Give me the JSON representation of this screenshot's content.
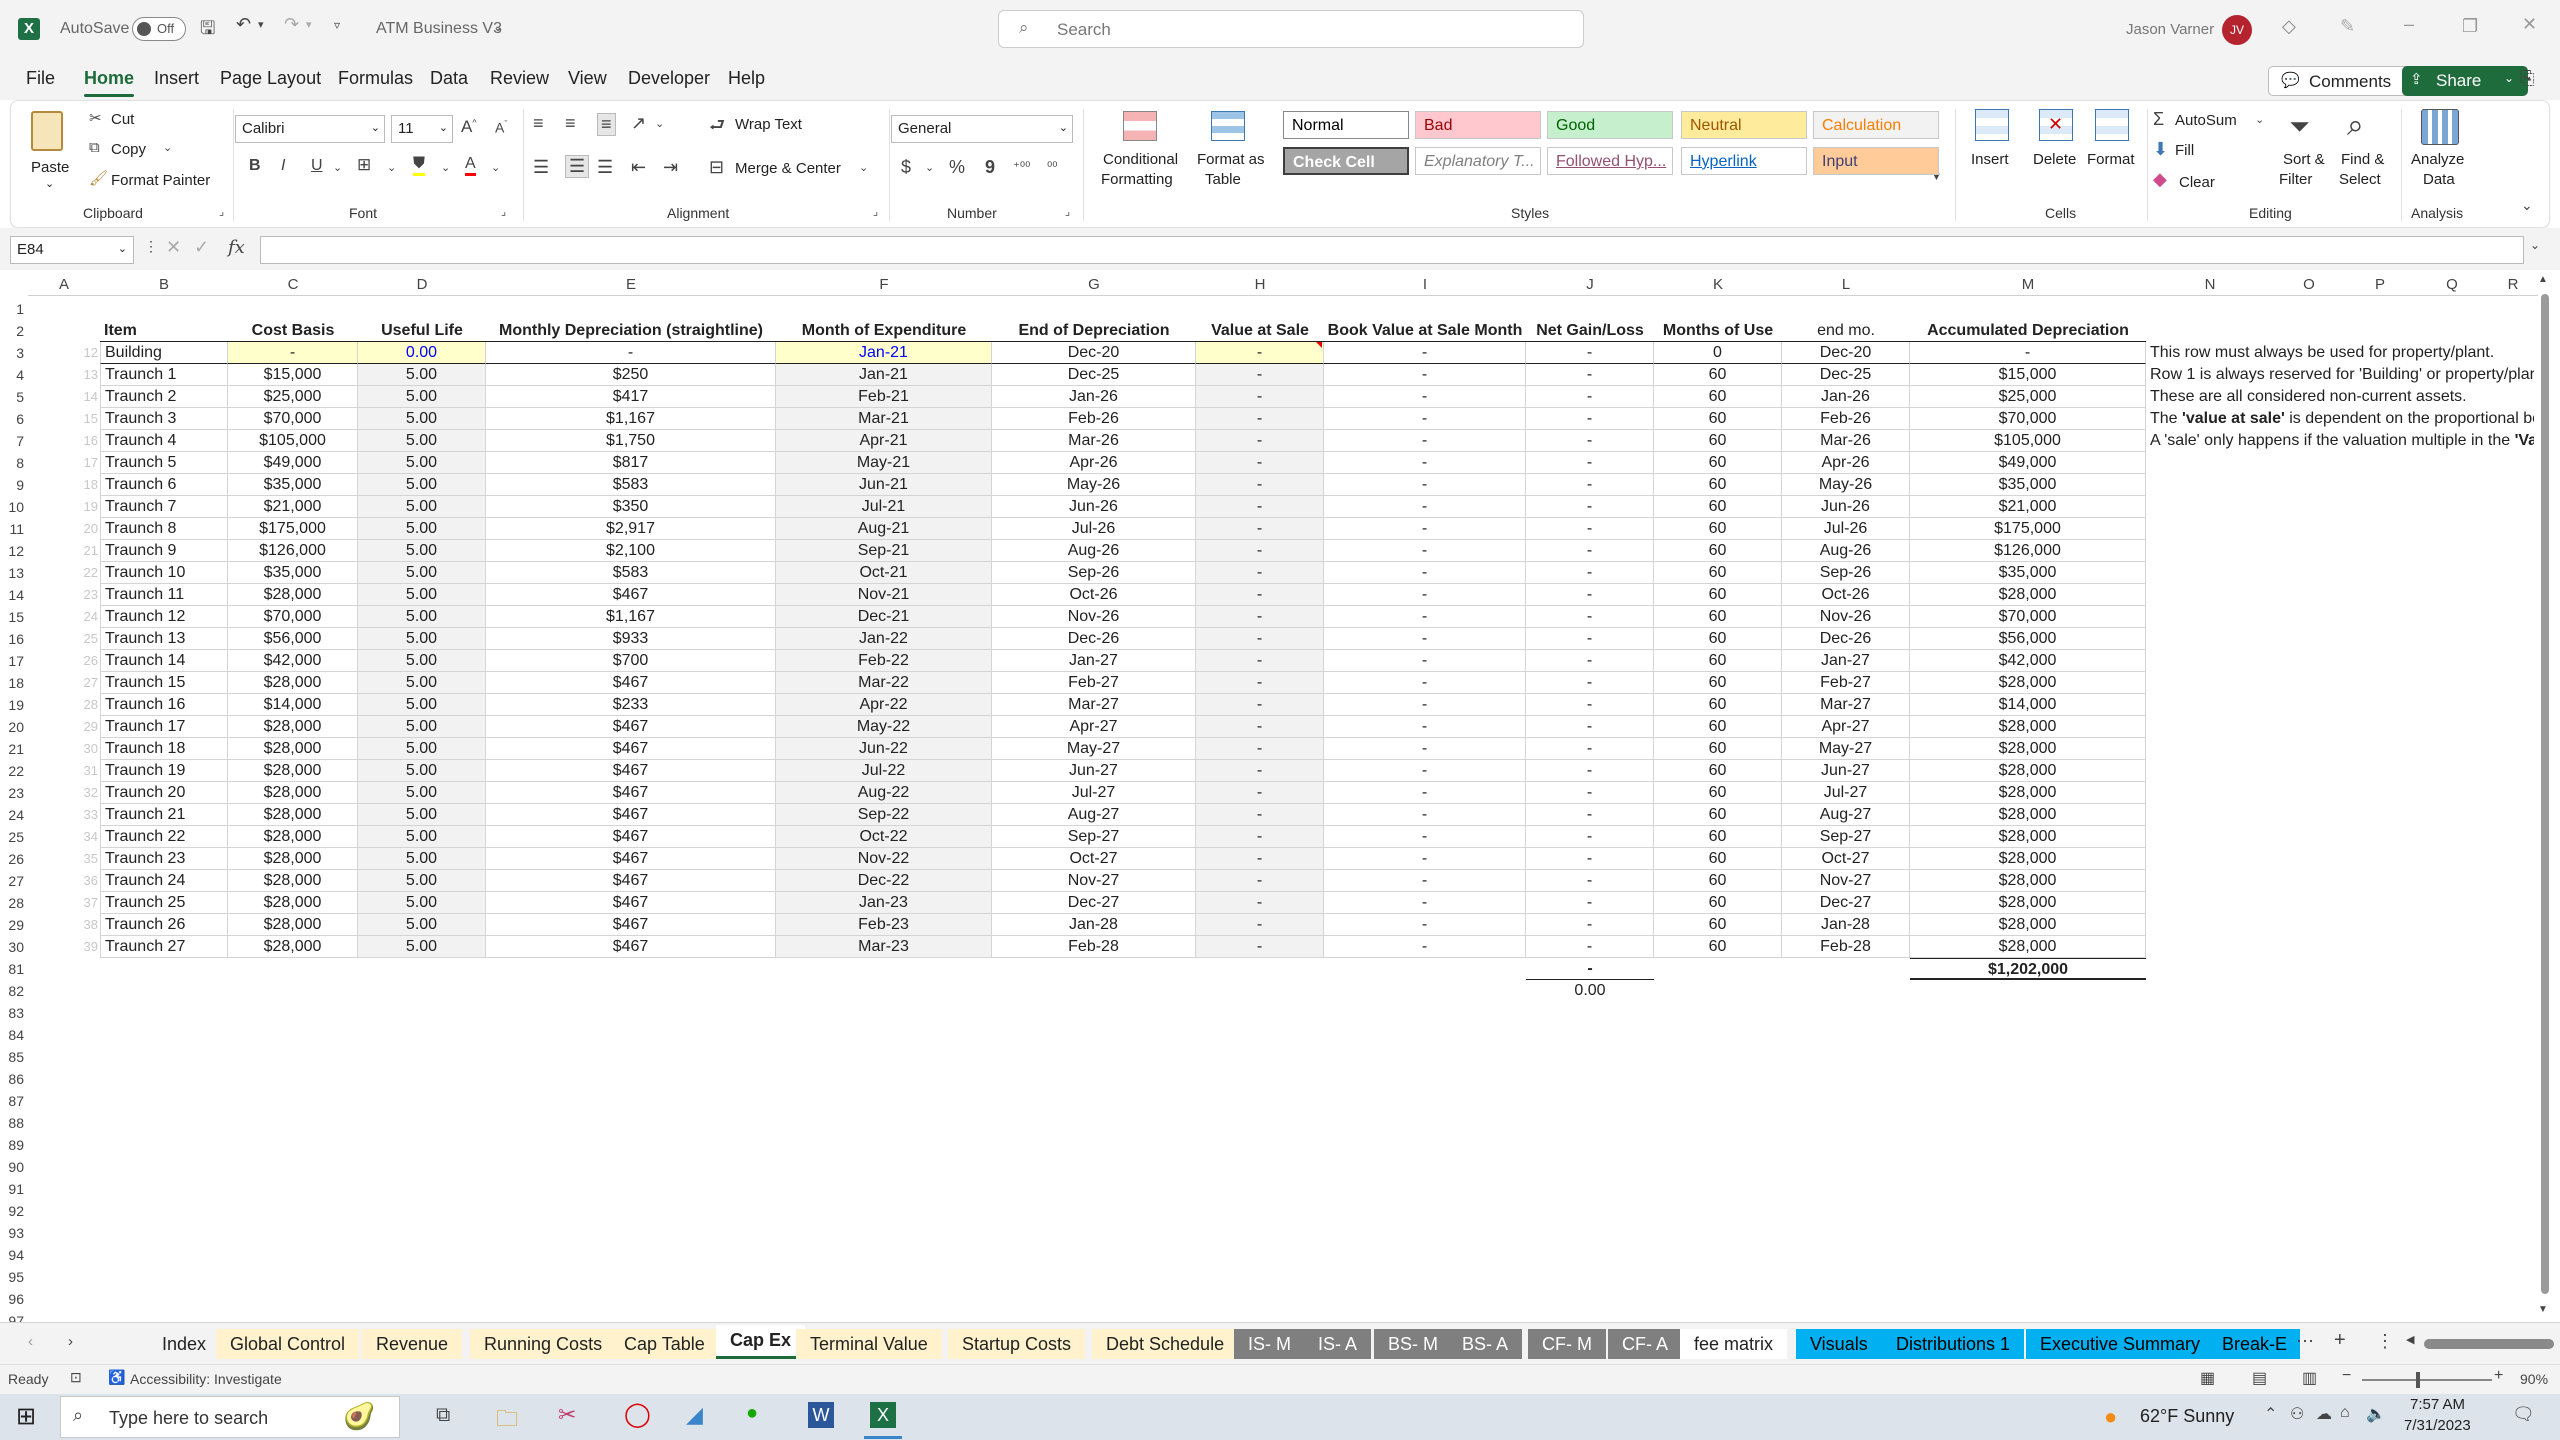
{
  "titlebar": {
    "autosave_label": "AutoSave",
    "autosave_state": "Off",
    "filename": "ATM Business V3",
    "search_placeholder": "Search",
    "user_name": "Jason Varner",
    "user_initials": "JV"
  },
  "menu": [
    "File",
    "Home",
    "Insert",
    "Page Layout",
    "Formulas",
    "Data",
    "Review",
    "View",
    "Developer",
    "Help"
  ],
  "menu_active": "Home",
  "menu_right": {
    "comments": "Comments",
    "share": "Share"
  },
  "ribbon": {
    "clipboard": {
      "paste": "Paste",
      "cut": "Cut",
      "copy": "Copy",
      "format_painter": "Format Painter",
      "group": "Clipboard"
    },
    "font": {
      "name": "Calibri",
      "size": "11",
      "group": "Font",
      "bold": "B",
      "italic": "I",
      "underline": "U"
    },
    "alignment": {
      "wrap": "Wrap Text",
      "merge": "Merge & Center",
      "group": "Alignment"
    },
    "number": {
      "format": "General",
      "group": "Number",
      "currency": "$",
      "percent": "%",
      "comma": "9"
    },
    "styles": {
      "conditional": "Conditional",
      "conditional2": "Formatting",
      "format_table": "Format as",
      "format_table2": "Table",
      "cells": [
        {
          "label": "Normal",
          "bg": "#ffffff",
          "fg": "#000000"
        },
        {
          "label": "Bad",
          "bg": "#ffc7ce",
          "fg": "#9c0006"
        },
        {
          "label": "Good",
          "bg": "#c6efce",
          "fg": "#006100"
        },
        {
          "label": "Neutral",
          "bg": "#ffeb9c",
          "fg": "#9c5700"
        },
        {
          "label": "Calculation",
          "bg": "#f2f2f2",
          "fg": "#fa7d00"
        },
        {
          "label": "Check Cell",
          "bg": "#a5a5a5",
          "fg": "#ffffff"
        },
        {
          "label": "Explanatory T...",
          "bg": "#ffffff",
          "fg": "#7f7f7f"
        },
        {
          "label": "Followed Hyp...",
          "bg": "#ffffff",
          "fg": "#954f72"
        },
        {
          "label": "Hyperlink",
          "bg": "#ffffff",
          "fg": "#0563c1"
        },
        {
          "label": "Input",
          "bg": "#ffcc99",
          "fg": "#3f3f76"
        }
      ],
      "group": "Styles"
    },
    "cells": {
      "insert": "Insert",
      "delete": "Delete",
      "format": "Format",
      "group": "Cells"
    },
    "editing": {
      "autosum": "AutoSum",
      "fill": "Fill",
      "clear": "Clear",
      "sort": "Sort &",
      "sort2": "Filter",
      "find": "Find &",
      "find2": "Select",
      "group": "Editing"
    },
    "analysis": {
      "analyze": "Analyze",
      "analyze2": "Data",
      "group": "Analysis"
    }
  },
  "formula_bar": {
    "name_box": "E84",
    "fx": "fx",
    "formula": ""
  },
  "columns": [
    "A",
    "B",
    "C",
    "D",
    "E",
    "F",
    "G",
    "H",
    "I",
    "J",
    "K",
    "L",
    "M",
    "N",
    "O",
    "P",
    "Q",
    "R"
  ],
  "row_numbers": [
    "1",
    "2",
    "3",
    "4",
    "5",
    "6",
    "7",
    "8",
    "9",
    "10",
    "11",
    "12",
    "13",
    "14",
    "15",
    "16",
    "17",
    "18",
    "19",
    "20",
    "21",
    "22",
    "23",
    "24",
    "25",
    "26",
    "27",
    "28",
    "29",
    "30",
    "81",
    "82",
    "83",
    "84",
    "85",
    "86",
    "87",
    "88",
    "89",
    "90",
    "91",
    "92",
    "93",
    "94",
    "95",
    "96",
    "97"
  ],
  "headers": [
    "Item",
    "Cost Basis",
    "Useful Life",
    "Monthly Depreciation (straightline)",
    "Month of Expenditure",
    "End of Depreciation",
    "Value at Sale",
    "Book Value at Sale Month",
    "Net Gain/Loss",
    "Months of Use",
    "end mo.",
    "Accumulated Depreciation"
  ],
  "rows": [
    {
      "n": "12",
      "item": "Building",
      "cost": "-",
      "life": "0.00",
      "monthly": "-",
      "month": "Jan-21",
      "end": "Dec-20",
      "value": "-",
      "book": "-",
      "net": "-",
      "months": "0",
      "endmo": "Dec-20",
      "accum": "-"
    },
    {
      "n": "13",
      "item": "Traunch 1",
      "cost": "$15,000",
      "life": "5.00",
      "monthly": "$250",
      "month": "Jan-21",
      "end": "Dec-25",
      "value": "-",
      "book": "-",
      "net": "-",
      "months": "60",
      "endmo": "Dec-25",
      "accum": "$15,000"
    },
    {
      "n": "14",
      "item": "Traunch 2",
      "cost": "$25,000",
      "life": "5.00",
      "monthly": "$417",
      "month": "Feb-21",
      "end": "Jan-26",
      "value": "-",
      "book": "-",
      "net": "-",
      "months": "60",
      "endmo": "Jan-26",
      "accum": "$25,000"
    },
    {
      "n": "15",
      "item": "Traunch 3",
      "cost": "$70,000",
      "life": "5.00",
      "monthly": "$1,167",
      "month": "Mar-21",
      "end": "Feb-26",
      "value": "-",
      "book": "-",
      "net": "-",
      "months": "60",
      "endmo": "Feb-26",
      "accum": "$70,000"
    },
    {
      "n": "16",
      "item": "Traunch 4",
      "cost": "$105,000",
      "life": "5.00",
      "monthly": "$1,750",
      "month": "Apr-21",
      "end": "Mar-26",
      "value": "-",
      "book": "-",
      "net": "-",
      "months": "60",
      "endmo": "Mar-26",
      "accum": "$105,000"
    },
    {
      "n": "17",
      "item": "Traunch 5",
      "cost": "$49,000",
      "life": "5.00",
      "monthly": "$817",
      "month": "May-21",
      "end": "Apr-26",
      "value": "-",
      "book": "-",
      "net": "-",
      "months": "60",
      "endmo": "Apr-26",
      "accum": "$49,000"
    },
    {
      "n": "18",
      "item": "Traunch 6",
      "cost": "$35,000",
      "life": "5.00",
      "monthly": "$583",
      "month": "Jun-21",
      "end": "May-26",
      "value": "-",
      "book": "-",
      "net": "-",
      "months": "60",
      "endmo": "May-26",
      "accum": "$35,000"
    },
    {
      "n": "19",
      "item": "Traunch 7",
      "cost": "$21,000",
      "life": "5.00",
      "monthly": "$350",
      "month": "Jul-21",
      "end": "Jun-26",
      "value": "-",
      "book": "-",
      "net": "-",
      "months": "60",
      "endmo": "Jun-26",
      "accum": "$21,000"
    },
    {
      "n": "20",
      "item": "Traunch 8",
      "cost": "$175,000",
      "life": "5.00",
      "monthly": "$2,917",
      "month": "Aug-21",
      "end": "Jul-26",
      "value": "-",
      "book": "-",
      "net": "-",
      "months": "60",
      "endmo": "Jul-26",
      "accum": "$175,000"
    },
    {
      "n": "21",
      "item": "Traunch 9",
      "cost": "$126,000",
      "life": "5.00",
      "monthly": "$2,100",
      "month": "Sep-21",
      "end": "Aug-26",
      "value": "-",
      "book": "-",
      "net": "-",
      "months": "60",
      "endmo": "Aug-26",
      "accum": "$126,000"
    },
    {
      "n": "22",
      "item": "Traunch 10",
      "cost": "$35,000",
      "life": "5.00",
      "monthly": "$583",
      "month": "Oct-21",
      "end": "Sep-26",
      "value": "-",
      "book": "-",
      "net": "-",
      "months": "60",
      "endmo": "Sep-26",
      "accum": "$35,000"
    },
    {
      "n": "23",
      "item": "Traunch 11",
      "cost": "$28,000",
      "life": "5.00",
      "monthly": "$467",
      "month": "Nov-21",
      "end": "Oct-26",
      "value": "-",
      "book": "-",
      "net": "-",
      "months": "60",
      "endmo": "Oct-26",
      "accum": "$28,000"
    },
    {
      "n": "24",
      "item": "Traunch 12",
      "cost": "$70,000",
      "life": "5.00",
      "monthly": "$1,167",
      "month": "Dec-21",
      "end": "Nov-26",
      "value": "-",
      "book": "-",
      "net": "-",
      "months": "60",
      "endmo": "Nov-26",
      "accum": "$70,000"
    },
    {
      "n": "25",
      "item": "Traunch 13",
      "cost": "$56,000",
      "life": "5.00",
      "monthly": "$933",
      "month": "Jan-22",
      "end": "Dec-26",
      "value": "-",
      "book": "-",
      "net": "-",
      "months": "60",
      "endmo": "Dec-26",
      "accum": "$56,000"
    },
    {
      "n": "26",
      "item": "Traunch 14",
      "cost": "$42,000",
      "life": "5.00",
      "monthly": "$700",
      "month": "Feb-22",
      "end": "Jan-27",
      "value": "-",
      "book": "-",
      "net": "-",
      "months": "60",
      "endmo": "Jan-27",
      "accum": "$42,000"
    },
    {
      "n": "27",
      "item": "Traunch 15",
      "cost": "$28,000",
      "life": "5.00",
      "monthly": "$467",
      "month": "Mar-22",
      "end": "Feb-27",
      "value": "-",
      "book": "-",
      "net": "-",
      "months": "60",
      "endmo": "Feb-27",
      "accum": "$28,000"
    },
    {
      "n": "28",
      "item": "Traunch 16",
      "cost": "$14,000",
      "life": "5.00",
      "monthly": "$233",
      "month": "Apr-22",
      "end": "Mar-27",
      "value": "-",
      "book": "-",
      "net": "-",
      "months": "60",
      "endmo": "Mar-27",
      "accum": "$14,000"
    },
    {
      "n": "29",
      "item": "Traunch 17",
      "cost": "$28,000",
      "life": "5.00",
      "monthly": "$467",
      "month": "May-22",
      "end": "Apr-27",
      "value": "-",
      "book": "-",
      "net": "-",
      "months": "60",
      "endmo": "Apr-27",
      "accum": "$28,000"
    },
    {
      "n": "30",
      "item": "Traunch 18",
      "cost": "$28,000",
      "life": "5.00",
      "monthly": "$467",
      "month": "Jun-22",
      "end": "May-27",
      "value": "-",
      "book": "-",
      "net": "-",
      "months": "60",
      "endmo": "May-27",
      "accum": "$28,000"
    },
    {
      "n": "31",
      "item": "Traunch 19",
      "cost": "$28,000",
      "life": "5.00",
      "monthly": "$467",
      "month": "Jul-22",
      "end": "Jun-27",
      "value": "-",
      "book": "-",
      "net": "-",
      "months": "60",
      "endmo": "Jun-27",
      "accum": "$28,000"
    },
    {
      "n": "32",
      "item": "Traunch 20",
      "cost": "$28,000",
      "life": "5.00",
      "monthly": "$467",
      "month": "Aug-22",
      "end": "Jul-27",
      "value": "-",
      "book": "-",
      "net": "-",
      "months": "60",
      "endmo": "Jul-27",
      "accum": "$28,000"
    },
    {
      "n": "33",
      "item": "Traunch 21",
      "cost": "$28,000",
      "life": "5.00",
      "monthly": "$467",
      "month": "Sep-22",
      "end": "Aug-27",
      "value": "-",
      "book": "-",
      "net": "-",
      "months": "60",
      "endmo": "Aug-27",
      "accum": "$28,000"
    },
    {
      "n": "34",
      "item": "Traunch 22",
      "cost": "$28,000",
      "life": "5.00",
      "monthly": "$467",
      "month": "Oct-22",
      "end": "Sep-27",
      "value": "-",
      "book": "-",
      "net": "-",
      "months": "60",
      "endmo": "Sep-27",
      "accum": "$28,000"
    },
    {
      "n": "35",
      "item": "Traunch 23",
      "cost": "$28,000",
      "life": "5.00",
      "monthly": "$467",
      "month": "Nov-22",
      "end": "Oct-27",
      "value": "-",
      "book": "-",
      "net": "-",
      "months": "60",
      "endmo": "Oct-27",
      "accum": "$28,000"
    },
    {
      "n": "36",
      "item": "Traunch 24",
      "cost": "$28,000",
      "life": "5.00",
      "monthly": "$467",
      "month": "Dec-22",
      "end": "Nov-27",
      "value": "-",
      "book": "-",
      "net": "-",
      "months": "60",
      "endmo": "Nov-27",
      "accum": "$28,000"
    },
    {
      "n": "37",
      "item": "Traunch 25",
      "cost": "$28,000",
      "life": "5.00",
      "monthly": "$467",
      "month": "Jan-23",
      "end": "Dec-27",
      "value": "-",
      "book": "-",
      "net": "-",
      "months": "60",
      "endmo": "Dec-27",
      "accum": "$28,000"
    },
    {
      "n": "38",
      "item": "Traunch 26",
      "cost": "$28,000",
      "life": "5.00",
      "monthly": "$467",
      "month": "Feb-23",
      "end": "Jan-28",
      "value": "-",
      "book": "-",
      "net": "-",
      "months": "60",
      "endmo": "Jan-28",
      "accum": "$28,000"
    },
    {
      "n": "39",
      "item": "Traunch 27",
      "cost": "$28,000",
      "life": "5.00",
      "monthly": "$467",
      "month": "Mar-23",
      "end": "Feb-28",
      "value": "-",
      "book": "-",
      "net": "-",
      "months": "60",
      "endmo": "Feb-28",
      "accum": "$28,000"
    }
  ],
  "totals": {
    "net_dash": "-",
    "net_value": "0.00",
    "accum_total": "$1,202,000"
  },
  "notes": [
    "This row must always be used for property/plant.",
    "Row 1 is always reserved for 'Building' or property/plar",
    "These are all considered non-current assets.",
    "The 'value at sale' is dependent on the proportional bo",
    "A 'sale' only happens if the valuation multiple in the 'Va"
  ],
  "sheet_tabs": [
    {
      "label": "Index",
      "bg": "#f3f3f3",
      "fg": "#222"
    },
    {
      "label": "Global Control",
      "bg": "#fff2cc",
      "fg": "#222"
    },
    {
      "label": "Revenue",
      "bg": "#fff2cc",
      "fg": "#222"
    },
    {
      "label": "Running Costs",
      "bg": "#fff2cc",
      "fg": "#222"
    },
    {
      "label": "Cap Table",
      "bg": "#fff2cc",
      "fg": "#222"
    },
    {
      "label": "Cap Ex",
      "bg": "#ffffff",
      "fg": "#222"
    },
    {
      "label": "Terminal Value",
      "bg": "#fff2cc",
      "fg": "#222"
    },
    {
      "label": "Startup Costs",
      "bg": "#fff2cc",
      "fg": "#222"
    },
    {
      "label": "Debt Schedule",
      "bg": "#fff2cc",
      "fg": "#222"
    },
    {
      "label": "IS- M",
      "bg": "#7f7f7f",
      "fg": "#ffffff"
    },
    {
      "label": "IS- A",
      "bg": "#7f7f7f",
      "fg": "#ffffff"
    },
    {
      "label": "BS- M",
      "bg": "#7f7f7f",
      "fg": "#ffffff"
    },
    {
      "label": "BS- A",
      "bg": "#7f7f7f",
      "fg": "#ffffff"
    },
    {
      "label": "CF- M",
      "bg": "#7f7f7f",
      "fg": "#ffffff"
    },
    {
      "label": "CF- A",
      "bg": "#7f7f7f",
      "fg": "#ffffff"
    },
    {
      "label": "fee matrix",
      "bg": "#ffffff",
      "fg": "#222"
    },
    {
      "label": "Visuals",
      "bg": "#00b0f0",
      "fg": "#000"
    },
    {
      "label": "Distributions 1",
      "bg": "#00b0f0",
      "fg": "#000"
    },
    {
      "label": "Executive Summary",
      "bg": "#00b0f0",
      "fg": "#000"
    },
    {
      "label": "Break-E",
      "bg": "#00b0f0",
      "fg": "#000"
    }
  ],
  "active_tab": "Cap Ex",
  "status": {
    "ready": "Ready",
    "accessibility": "Accessibility: Investigate",
    "zoom": "90%"
  },
  "taskbar": {
    "search_placeholder": "Type here to search",
    "weather": "62°F  Sunny",
    "time": "7:57 AM",
    "date": "7/31/2023"
  }
}
